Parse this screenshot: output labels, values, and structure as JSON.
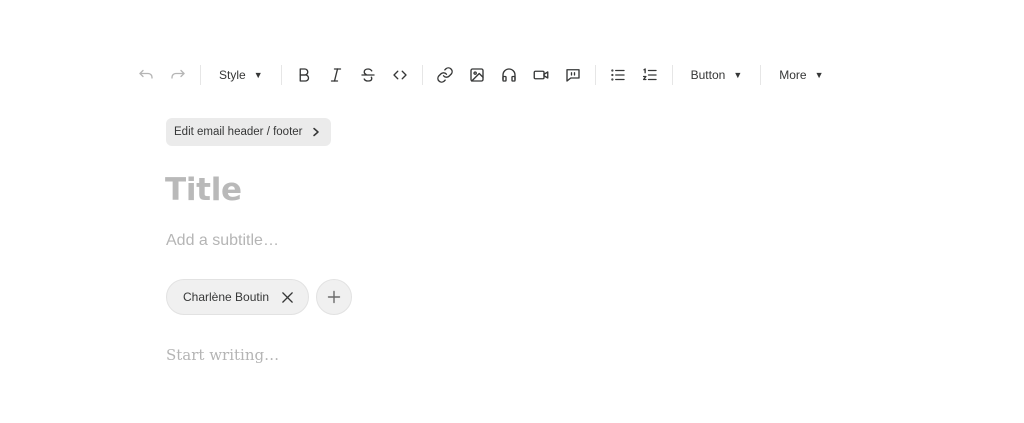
{
  "toolbar": {
    "undo_icon": "undo-icon",
    "redo_icon": "redo-icon",
    "style_label": "Style",
    "format_icons": [
      "bold-icon",
      "italic-icon",
      "strikethrough-icon",
      "code-icon"
    ],
    "insert_icons": [
      "link-icon",
      "image-icon",
      "audio-icon",
      "video-icon",
      "quote-icon"
    ],
    "list_icons": [
      "bullet-list-icon",
      "numbered-list-icon"
    ],
    "button_label": "Button",
    "more_label": "More",
    "caret": "▼"
  },
  "header_footer": {
    "label": "Edit email header / footer"
  },
  "post": {
    "title_placeholder": "Title",
    "subtitle_placeholder": "Add a subtitle…",
    "body_placeholder": "Start writing…"
  },
  "byline": {
    "author_name": "Charlène Boutin"
  },
  "colors": {
    "text": "#363737",
    "placeholder": "#b5b5b5",
    "pill_bg": "#ebebeb",
    "separator": "#e6e6e6"
  }
}
